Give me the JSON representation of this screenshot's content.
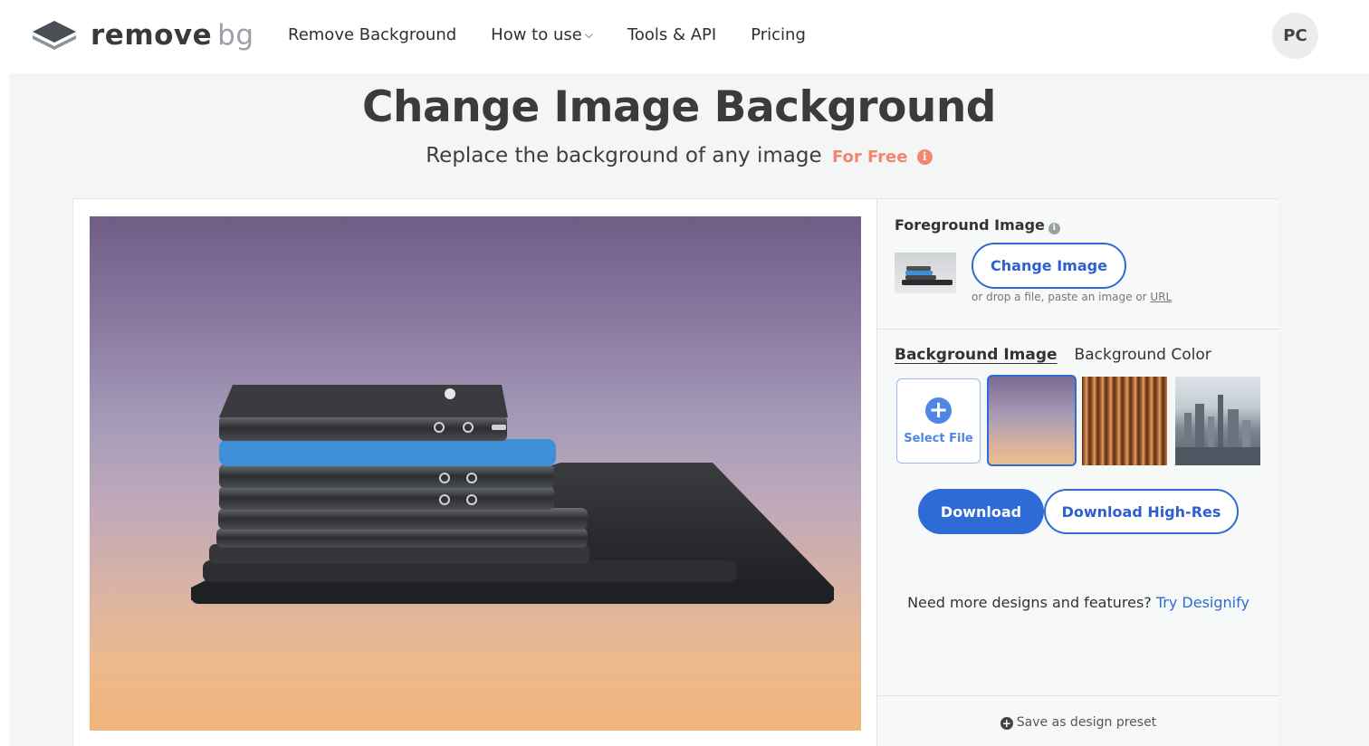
{
  "header": {
    "logo_text": "remove",
    "logo_text_bg": "bg",
    "nav": [
      {
        "label": "Remove Background"
      },
      {
        "label": "How to use"
      },
      {
        "label": "Tools & API"
      },
      {
        "label": "Pricing"
      }
    ],
    "avatar_initials": "PC"
  },
  "hero": {
    "title": "Change Image Background",
    "subtitle": "Replace the background of any image",
    "free_label": "For Free",
    "info_glyph": "i"
  },
  "editor": {
    "foreground": {
      "title": "Foreground Image",
      "change_button": "Change Image",
      "drop_hint": "or drop a file, paste an image or",
      "drop_hint_link": "URL"
    },
    "tabs": [
      {
        "label": "Background Image",
        "active": true
      },
      {
        "label": "Background Color",
        "active": false
      }
    ],
    "select_file_label": "Select File",
    "download_button": "Download",
    "download_hires_button": "Download High-Res",
    "designify_text": "Need more designs and features?",
    "designify_link": "Try Designify",
    "save_preset": "Save as design preset"
  },
  "colors": {
    "accent": "#2e6bd6",
    "free": "#f2866f"
  }
}
